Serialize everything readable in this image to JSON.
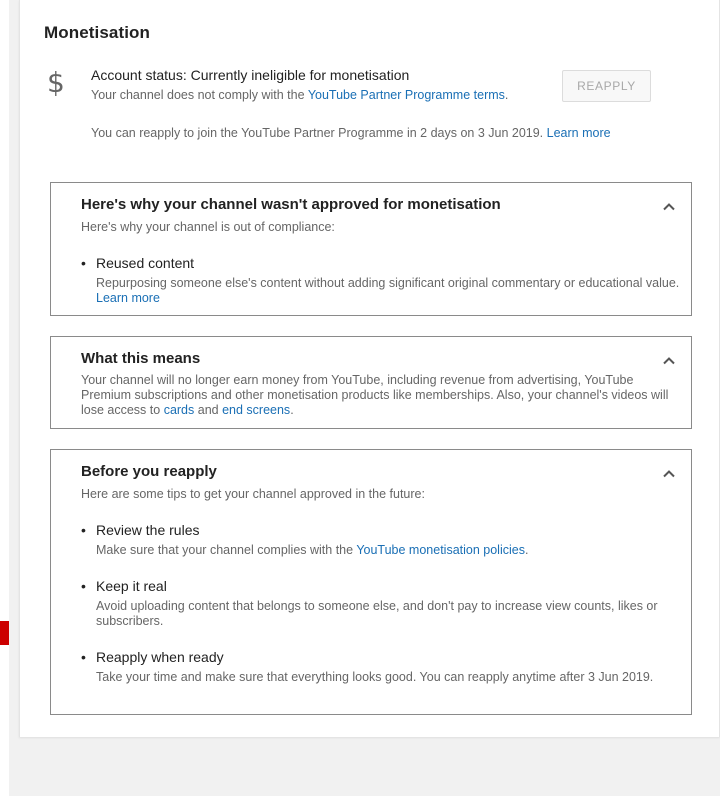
{
  "header": {
    "title": "Monetisation"
  },
  "account": {
    "icon": "dollar-icon",
    "status": "Account status: Currently ineligible for monetisation",
    "comply_text": "Your channel does not comply with the ",
    "comply_link": "YouTube Partner Programme terms",
    "comply_end": ".",
    "reapply_button": "REAPPLY",
    "reapply_text": "You can reapply to join the YouTube Partner Programme in 2 days on 3 Jun 2019. ",
    "reapply_link": "Learn more"
  },
  "why": {
    "title": "Here's why your channel wasn't approved for monetisation",
    "subtitle": "Here's why your channel is out of compliance:",
    "item_title": "Reused content",
    "item_desc": "Repurposing someone else's content without adding significant original commentary or educational value. ",
    "item_link": "Learn more"
  },
  "means": {
    "title": "What this means",
    "text": "Your channel will no longer earn money from YouTube, including revenue from advertising, YouTube Premium subscriptions and other monetisation products like memberships. Also, your channel's videos will lose access to ",
    "link1": "cards",
    "and": " and ",
    "link2": "end screens",
    "end": "."
  },
  "before": {
    "title": "Before you reapply",
    "subtitle": "Here are some tips to get your channel approved in the future:",
    "tips": [
      {
        "title": "Review the rules",
        "desc": "Make sure that your channel complies with the ",
        "link": "YouTube monetisation policies",
        "end": "."
      },
      {
        "title": "Keep it real",
        "desc": "Avoid uploading content that belongs to someone else, and don't pay to increase view counts, likes or subscribers."
      },
      {
        "title": "Reapply when ready",
        "desc": "Take your time and make sure that everything looks good. You can reapply anytime after 3 Jun 2019."
      }
    ]
  },
  "colors": {
    "link": "#1a6fb5",
    "accent_red": "#cc0000",
    "border": "#8a8a8a"
  }
}
